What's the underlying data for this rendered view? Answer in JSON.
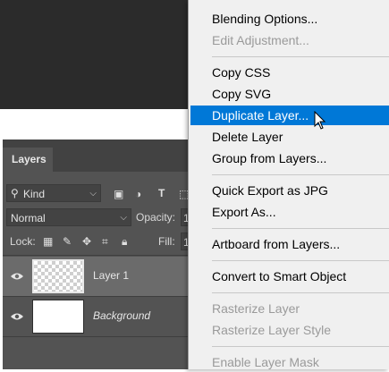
{
  "layers_panel": {
    "tab": "Layers",
    "filter": {
      "value": "Kind"
    },
    "blend_mode": {
      "value": "Normal"
    },
    "opacity_label": "Opacity:",
    "opacity_value": "1",
    "lock_label": "Lock:",
    "fill_label": "Fill:",
    "fill_value": "1",
    "layers": [
      {
        "name": "Layer 1",
        "thumbnail": "transparent",
        "visible": true,
        "selected": true
      },
      {
        "name": "Background",
        "thumbnail": "white",
        "visible": true,
        "selected": false
      }
    ]
  },
  "context_menu": {
    "items": [
      {
        "label": "Blending Options...",
        "enabled": true
      },
      {
        "label": "Edit Adjustment...",
        "enabled": false
      },
      {
        "label": "Copy CSS",
        "enabled": true
      },
      {
        "label": "Copy SVG",
        "enabled": true
      },
      {
        "label": "Duplicate Layer...",
        "enabled": true,
        "highlighted": true
      },
      {
        "label": "Delete Layer",
        "enabled": true
      },
      {
        "label": "Group from Layers...",
        "enabled": true
      },
      {
        "label": "Quick Export as JPG",
        "enabled": true
      },
      {
        "label": "Export As...",
        "enabled": true
      },
      {
        "label": "Artboard from Layers...",
        "enabled": true
      },
      {
        "label": "Convert to Smart Object",
        "enabled": true
      },
      {
        "label": "Rasterize Layer",
        "enabled": false
      },
      {
        "label": "Rasterize Layer Style",
        "enabled": false
      },
      {
        "label": "Enable Layer Mask",
        "enabled": false
      }
    ]
  },
  "colors": {
    "highlight": "#0078d7",
    "panel": "#535353",
    "menu_bg": "#f0f0f0"
  }
}
